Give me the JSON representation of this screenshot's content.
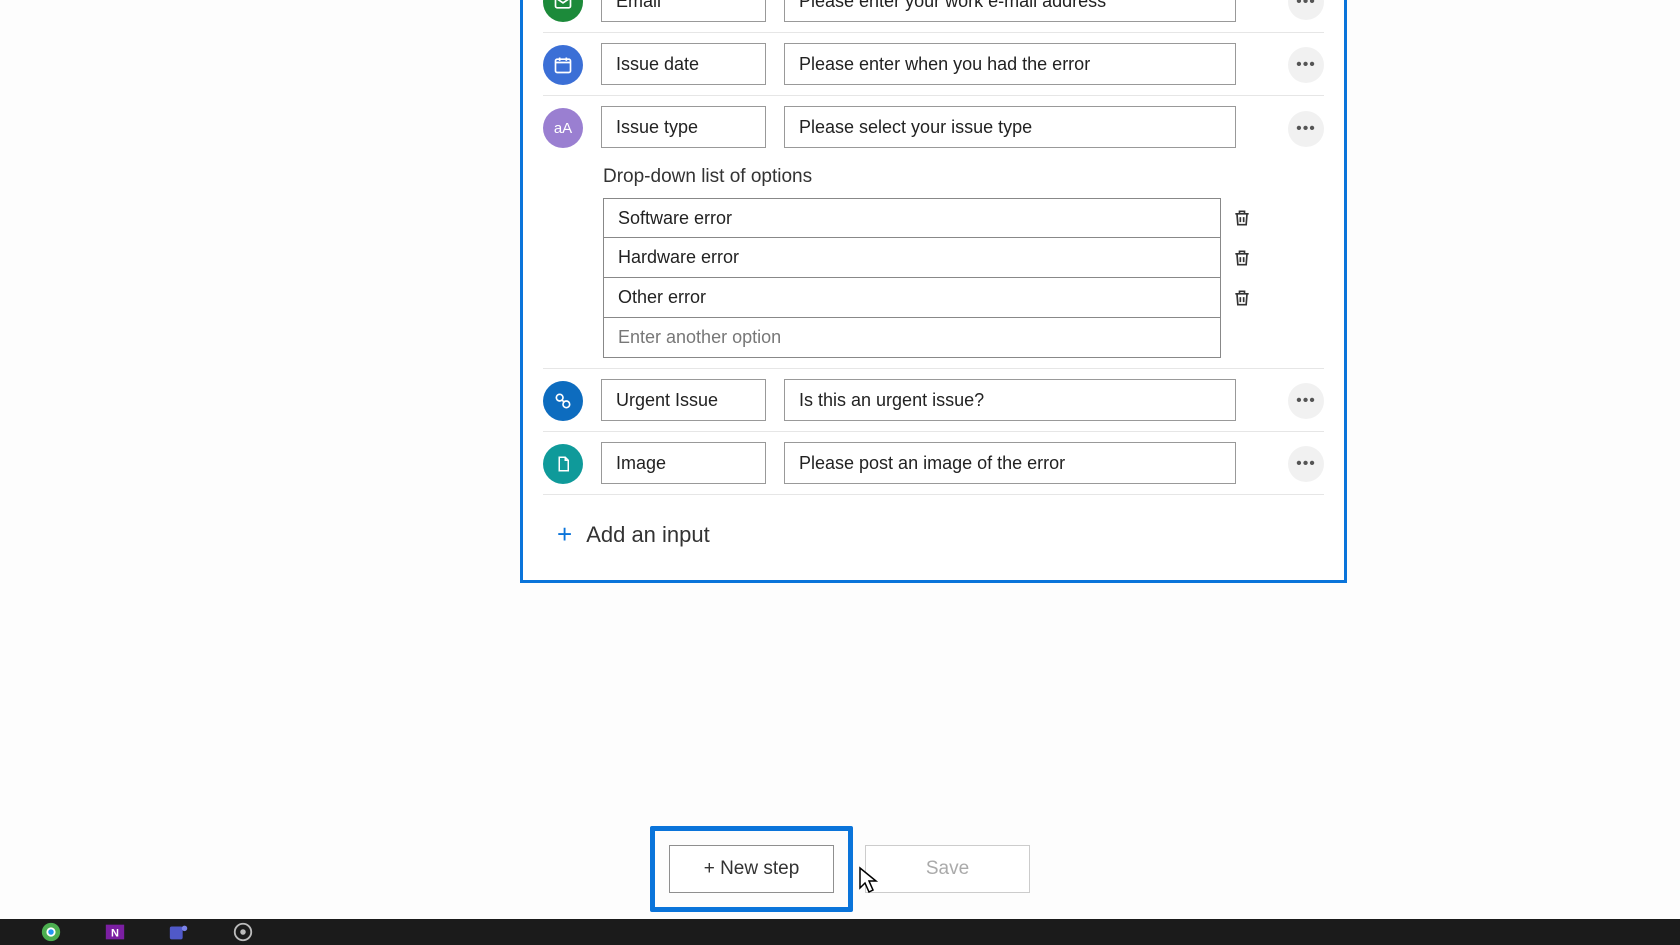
{
  "inputs": {
    "email": {
      "name": "Email",
      "desc": "Please enter your work e-mail address"
    },
    "date": {
      "name": "Issue date",
      "desc": "Please enter when you had the error"
    },
    "type": {
      "name": "Issue type",
      "desc": "Please select your issue type"
    },
    "urgent": {
      "name": "Urgent Issue",
      "desc": "Is this an urgent issue?"
    },
    "image": {
      "name": "Image",
      "desc": "Please post an image of the error"
    }
  },
  "dropdown": {
    "label": "Drop-down list of options",
    "options": [
      "Software error",
      "Hardware error",
      "Other error"
    ],
    "placeholder": "Enter another option"
  },
  "addInputLabel": "Add an input",
  "buttons": {
    "newStep": "+ New step",
    "save": "Save"
  },
  "iconText": {
    "type": "aA"
  }
}
